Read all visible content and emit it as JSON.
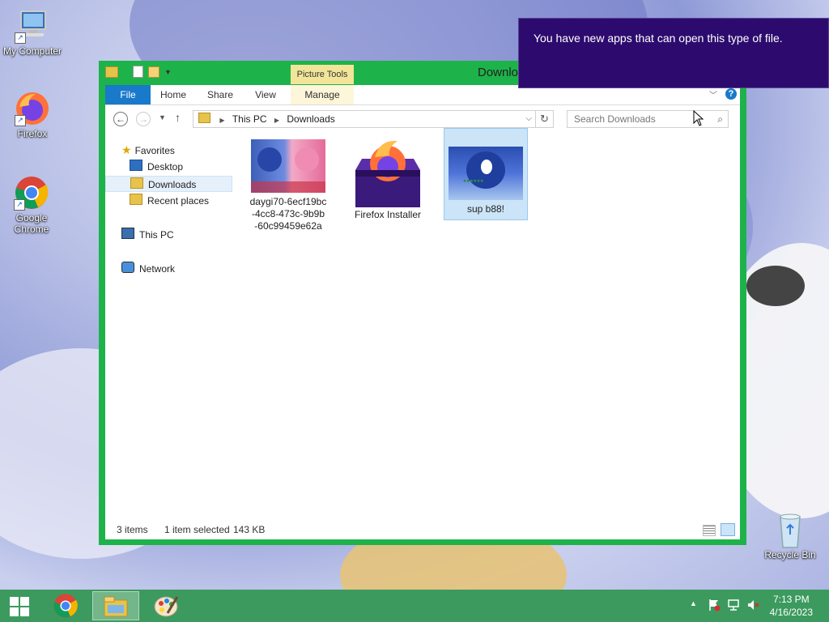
{
  "desktop": {
    "icons": [
      {
        "label": "My Computer"
      },
      {
        "label": "Firefox"
      },
      {
        "label": "Google Chrome"
      },
      {
        "label": "Recycle Bin"
      }
    ]
  },
  "window": {
    "title": "Downloads",
    "contextual_tab_group": "Picture Tools",
    "ribbon_tabs": [
      "File",
      "Home",
      "Share",
      "View",
      "Manage"
    ],
    "breadcrumb": [
      "This PC",
      "Downloads"
    ],
    "search_placeholder": "Search Downloads",
    "nav": {
      "favorites": "Favorites",
      "desktop": "Desktop",
      "downloads": "Downloads",
      "recent": "Recent places",
      "this_pc": "This PC",
      "network": "Network"
    },
    "files": [
      {
        "name": "daygi70-6ecf19bc-4cc8-473c-9b9b-60c99459e62a",
        "name_lines": [
          "daygi70-6ecf19bc",
          "-4cc8-473c-9b9b",
          "-60c99459e62a"
        ]
      },
      {
        "name": "Firefox Installer",
        "name_lines": [
          "Firefox Installer"
        ]
      },
      {
        "name": "sup b88!",
        "name_lines": [
          "sup b88!"
        ],
        "selected": true
      }
    ],
    "status": {
      "count": "3 items",
      "selection": "1 item selected",
      "size": "143 KB"
    }
  },
  "toast": {
    "message": "You have new apps that can open this type of file."
  },
  "taskbar": {
    "time": "7:13 PM",
    "date": "4/16/2023"
  },
  "colors": {
    "window_frame": "#1db34a",
    "file_tab": "#1979ca",
    "toast_bg": "#2d0b6e",
    "taskbar": "#3c9a5e",
    "selection": "#cce4f7"
  }
}
